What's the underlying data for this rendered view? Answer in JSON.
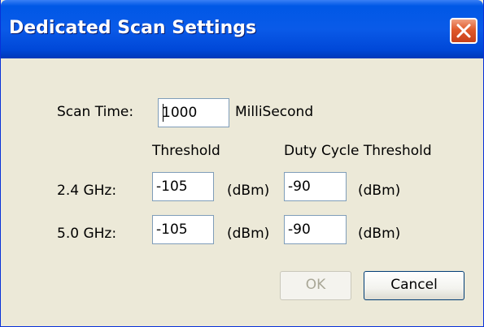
{
  "window": {
    "title": "Dedicated Scan Settings"
  },
  "scan_time": {
    "label": "Scan Time:",
    "value": "1000",
    "unit": "MilliSecond"
  },
  "columns": {
    "threshold": "Threshold",
    "duty_cycle": "Duty Cycle Threshold"
  },
  "rows": [
    {
      "label": "2.4 GHz:",
      "threshold": "-105",
      "threshold_unit": "(dBm)",
      "duty_cycle": "-90",
      "duty_cycle_unit": "(dBm)"
    },
    {
      "label": "5.0 GHz:",
      "threshold": "-105",
      "threshold_unit": "(dBm)",
      "duty_cycle": "-90",
      "duty_cycle_unit": "(dBm)"
    }
  ],
  "buttons": {
    "ok": "OK",
    "ok_enabled": false,
    "cancel": "Cancel"
  },
  "colors": {
    "title_bar": "#0058e6",
    "window_bg": "#ece9d8",
    "close_button": "#e05a2a"
  },
  "icons": {
    "close": "close-icon"
  }
}
